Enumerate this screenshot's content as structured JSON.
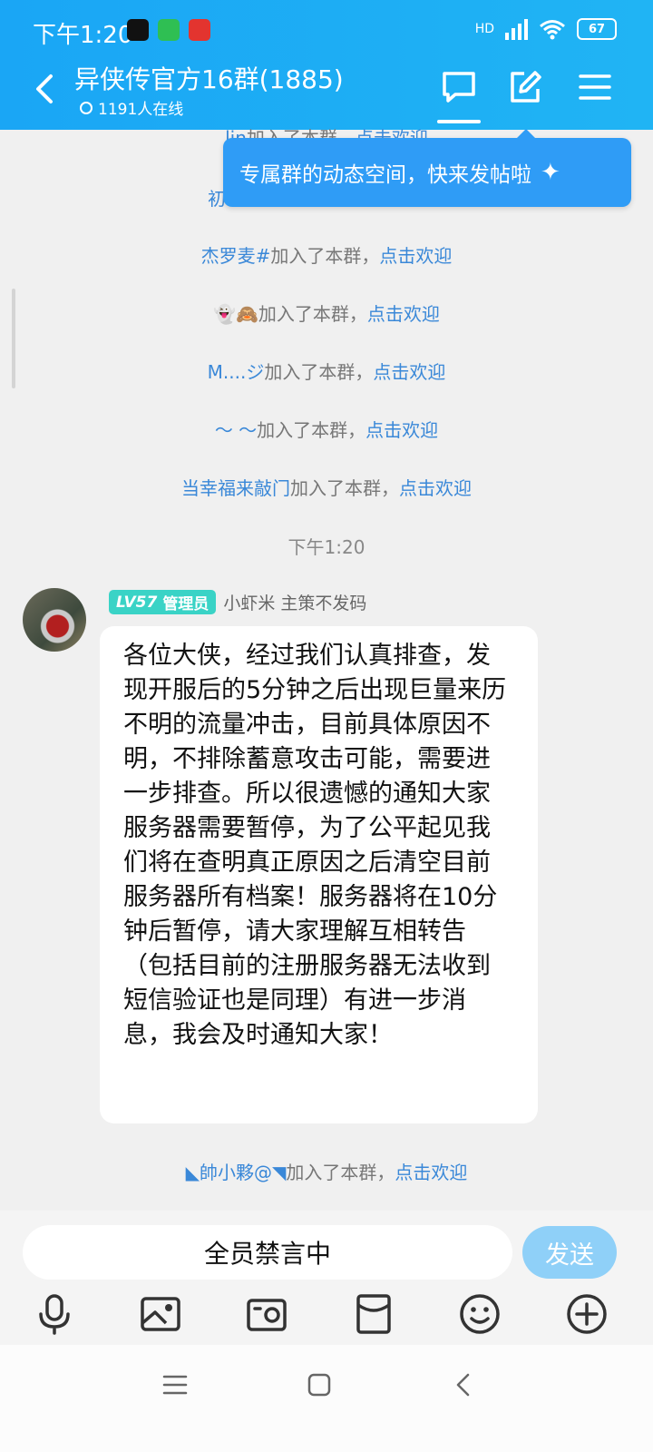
{
  "status_bar": {
    "time": "下午1:20",
    "network": "HD",
    "battery": "67"
  },
  "header": {
    "title": "异侠传官方16群(1885)",
    "online": "1191人在线"
  },
  "tooltip": {
    "text": "专属群的动态空间，快来发帖啦"
  },
  "chat": {
    "join_suffix": "加入了本群，",
    "welcome": "点击欢迎",
    "joins": [
      {
        "name": "lin"
      },
      {
        "name": "初"
      },
      {
        "name": "杰罗麦#"
      },
      {
        "name": "👻🙈"
      },
      {
        "name": "M....ジ"
      },
      {
        "name": "～ ～"
      },
      {
        "name": "当幸福来敲门"
      }
    ],
    "timestamp": "下午1:20",
    "message": {
      "level": "LV57",
      "role": "管理员",
      "sender": "小虾米 主策不发码",
      "text": "各位大侠，经过我们认真排查，发现开服后的5分钟之后出现巨量来历不明的流量冲击，目前具体原因不明，不排除蓄意攻击可能，需要进一步排查。所以很遗憾的通知大家服务器需要暂停，为了公平起见我们将在查明真正原因之后清空目前服务器所有档案！服务器将在10分钟后暂停，请大家理解互相转告（包括目前的注册服务器无法收到短信验证也是同理）有进一步消息，我会及时通知大家！"
    },
    "last_join": {
      "name": "◣帥小夥@◥"
    }
  },
  "input": {
    "placeholder": "全员禁言中",
    "send": "发送"
  },
  "colors": {
    "header": "#1aa6f5",
    "link": "#3a88d8",
    "badge": "#3ad3c6",
    "send_disabled": "#8fd0f8"
  }
}
